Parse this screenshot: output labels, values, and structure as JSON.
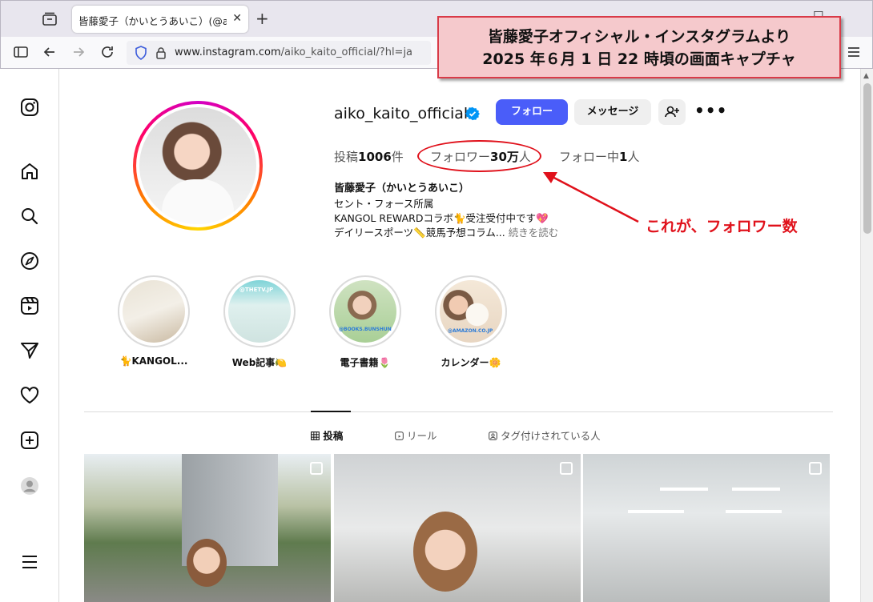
{
  "browser": {
    "tab_title": "皆藤愛子（かいとうあいこ）(@aiko_ka",
    "url_prefix": "www.instagram.com",
    "url_path": "/aiko_kaito_official/?hl=ja"
  },
  "annotation": {
    "callout_line1": "皆藤愛子オフィシャル・インスタグラムより",
    "callout_line2": "2025 年６月 1 日 22 時頃の画面キャプチャ",
    "followers_note": "これが、フォロワー数"
  },
  "profile": {
    "username": "aiko_kaito_official",
    "follow_label": "フォロー",
    "message_label": "メッセージ",
    "posts_prefix": "投稿",
    "posts_count": "1006",
    "posts_suffix": "件",
    "followers_prefix": "フォロワー",
    "followers_count": "30万",
    "followers_suffix": "人",
    "following_prefix": "フォロー中",
    "following_count": "1",
    "following_suffix": "人",
    "bio_name": "皆藤愛子（かいとうあいこ）",
    "bio_line1": "セント・フォース所属",
    "bio_line2": "KANGOL REWARDコラボ🐈受注受付中です💖",
    "bio_line3": "デイリースポーツ📏競馬予想コラム...",
    "bio_more": "続きを読む"
  },
  "highlights": [
    {
      "label": "🐈KANGOL..."
    },
    {
      "label": "Web記事🍋"
    },
    {
      "label": "電子書籍🌷"
    },
    {
      "label": "カレンダー🌼"
    }
  ],
  "highlight_tags": {
    "h2": "@THETV.JP",
    "h3": "@BOOKS.BUNSHUN",
    "h4": "@AMAZON.CO.JP"
  },
  "profile_tabs": {
    "posts": "投稿",
    "reels": "リール",
    "tagged": "タグ付けされている人"
  },
  "colors": {
    "follow_button": "#4a5df9",
    "annotation_red": "#e0111b",
    "callout_bg": "#f5c9cc"
  }
}
